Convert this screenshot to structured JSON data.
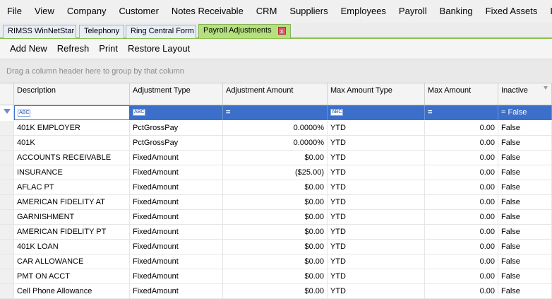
{
  "menu": [
    "File",
    "View",
    "Company",
    "Customer",
    "Notes Receivable",
    "CRM",
    "Suppliers",
    "Employees",
    "Payroll",
    "Banking",
    "Fixed Assets",
    "Inver"
  ],
  "tabs": [
    {
      "label": "RIMSS WinNetStar"
    },
    {
      "label": "Telephony"
    },
    {
      "label": "Ring Central Form"
    },
    {
      "label": "Payroll Adjustments",
      "active": true,
      "close_glyph": "x"
    }
  ],
  "toolbar": {
    "add_new": "Add New",
    "refresh": "Refresh",
    "print": "Print",
    "restore_layout": "Restore Layout"
  },
  "group_panel": {
    "hint": "Drag a column header here to group by that column"
  },
  "columns": [
    "Description",
    "Adjustment Type",
    "Adjustment Amount",
    "Max Amount Type",
    "Max Amount",
    "Inactive"
  ],
  "filter": {
    "abc": "ABC",
    "eq": "=",
    "inactive": "= False"
  },
  "rows": [
    [
      "401K EMPLOYER",
      "PctGrossPay",
      "0.0000%",
      "YTD",
      "0.00",
      "False"
    ],
    [
      "401K",
      "PctGrossPay",
      "0.0000%",
      "YTD",
      "0.00",
      "False"
    ],
    [
      "ACCOUNTS RECEIVABLE",
      "FixedAmount",
      "$0.00",
      "YTD",
      "0.00",
      "False"
    ],
    [
      "INSURANCE",
      "FixedAmount",
      "($25.00)",
      "YTD",
      "0.00",
      "False"
    ],
    [
      "AFLAC PT",
      "FixedAmount",
      "$0.00",
      "YTD",
      "0.00",
      "False"
    ],
    [
      "AMERICAN FIDELITY AT",
      "FixedAmount",
      "$0.00",
      "YTD",
      "0.00",
      "False"
    ],
    [
      "GARNISHMENT",
      "FixedAmount",
      "$0.00",
      "YTD",
      "0.00",
      "False"
    ],
    [
      "AMERICAN FIDELITY PT",
      "FixedAmount",
      "$0.00",
      "YTD",
      "0.00",
      "False"
    ],
    [
      "401K LOAN",
      "FixedAmount",
      "$0.00",
      "YTD",
      "0.00",
      "False"
    ],
    [
      "CAR ALLOWANCE",
      "FixedAmount",
      "$0.00",
      "YTD",
      "0.00",
      "False"
    ],
    [
      "PMT ON ACCT",
      "FixedAmount",
      "$0.00",
      "YTD",
      "0.00",
      "False"
    ],
    [
      "Cell Phone Allowance",
      "FixedAmount",
      "$0.00",
      "YTD",
      "0.00",
      "False"
    ]
  ]
}
